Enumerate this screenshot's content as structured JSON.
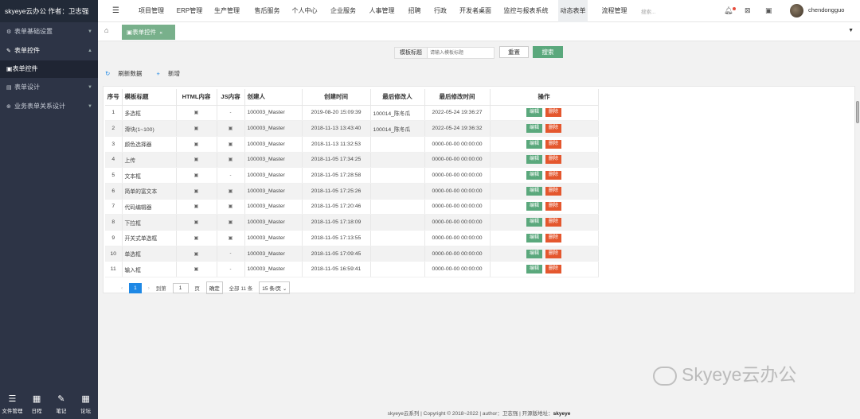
{
  "brand": "skyeye云办公 作者：卫志强",
  "sidebar": {
    "items": [
      {
        "label": "表单基础设置",
        "icon": "users-cog-icon",
        "glyph": "⚙",
        "arrow": "▼",
        "open": false
      },
      {
        "label": "表单控件",
        "icon": "wrench-icon",
        "glyph": "✎",
        "arrow": "▲",
        "open": true
      },
      {
        "label": "表单设计",
        "icon": "layers-icon",
        "glyph": "▤",
        "arrow": "▼",
        "open": false
      },
      {
        "label": "业务表单关系设计",
        "icon": "branch-icon",
        "glyph": "⊕",
        "arrow": "▼",
        "open": false
      }
    ],
    "sub_item": {
      "label": "表单控件",
      "icon": "file-icon",
      "glyph": "▣"
    },
    "bottom_tools": [
      {
        "label": "文件管理",
        "icon": "list-icon",
        "glyph": "☰"
      },
      {
        "label": "日程",
        "icon": "calendar-icon",
        "glyph": "▦"
      },
      {
        "label": "笔记",
        "icon": "edit-icon",
        "glyph": "✎"
      },
      {
        "label": "论坛",
        "icon": "grid-icon",
        "glyph": "▦"
      }
    ]
  },
  "topnav": {
    "menu_glyph": "☰",
    "items": [
      "项目管理",
      "ERP管理",
      "生产管理",
      "售后服务",
      "个人中心",
      "企业服务",
      "人事管理",
      "招聘",
      "行政",
      "开发者桌面",
      "监控与报表系统",
      "动态表单",
      "流程管理"
    ],
    "active_index": 11,
    "search_placeholder": "搜索...",
    "icons": [
      {
        "name": "bell-icon",
        "glyph": "♫"
      },
      {
        "name": "gallery-icon",
        "glyph": "⊠"
      },
      {
        "name": "window-icon",
        "glyph": "▣"
      }
    ],
    "notification_color": "#e74c3c",
    "username": "chendongguo"
  },
  "tabs": {
    "home_glyph": "⌂",
    "active": {
      "label": "表单控件",
      "icon_glyph": "▣",
      "close_glyph": "✕"
    },
    "dropdown_glyph": "▼"
  },
  "search": {
    "label": "模板标题",
    "placeholder": "请输入模板标题",
    "reset_label": "重置",
    "search_label": "搜索"
  },
  "toolbar": {
    "refresh_label": "刷新数据",
    "refresh_glyph": "↻",
    "add_label": "新增",
    "add_glyph": "+"
  },
  "table": {
    "headers": [
      "序号",
      "模板标题",
      "HTML内容",
      "JS内容",
      "创建人",
      "创建时间",
      "最后修改人",
      "最后修改时间",
      "操作"
    ],
    "edit_label": "编辑",
    "delete_label": "删除",
    "rows": [
      {
        "no": "1",
        "title": "多选框",
        "html": "▣",
        "js": "-",
        "creator": "100003_Master",
        "created": "2019-08-20 15:09:39",
        "modifier": "100014_陈冬瓜",
        "modified": "2022-05-24 19:36:27"
      },
      {
        "no": "2",
        "title": "滑块(1~100)",
        "html": "▣",
        "js": "▣",
        "creator": "100003_Master",
        "created": "2018-11-13 13:43:40",
        "modifier": "100014_陈冬瓜",
        "modified": "2022-05-24 19:36:32"
      },
      {
        "no": "3",
        "title": "颜色选择器",
        "html": "▣",
        "js": "▣",
        "creator": "100003_Master",
        "created": "2018-11-13 11:32:53",
        "modifier": "",
        "modified": "0000-00-00 00:00:00"
      },
      {
        "no": "4",
        "title": "上传",
        "html": "▣",
        "js": "▣",
        "creator": "100003_Master",
        "created": "2018-11-05 17:34:25",
        "modifier": "",
        "modified": "0000-00-00 00:00:00"
      },
      {
        "no": "5",
        "title": "文本框",
        "html": "▣",
        "js": "-",
        "creator": "100003_Master",
        "created": "2018-11-05 17:28:58",
        "modifier": "",
        "modified": "0000-00-00 00:00:00"
      },
      {
        "no": "6",
        "title": "简单的富文本",
        "html": "▣",
        "js": "▣",
        "creator": "100003_Master",
        "created": "2018-11-05 17:25:26",
        "modifier": "",
        "modified": "0000-00-00 00:00:00"
      },
      {
        "no": "7",
        "title": "代码编辑器",
        "html": "▣",
        "js": "▣",
        "creator": "100003_Master",
        "created": "2018-11-05 17:20:46",
        "modifier": "",
        "modified": "0000-00-00 00:00:00"
      },
      {
        "no": "8",
        "title": "下拉框",
        "html": "▣",
        "js": "▣",
        "creator": "100003_Master",
        "created": "2018-11-05 17:18:09",
        "modifier": "",
        "modified": "0000-00-00 00:00:00"
      },
      {
        "no": "9",
        "title": "开关式单选框",
        "html": "▣",
        "js": "▣",
        "creator": "100003_Master",
        "created": "2018-11-05 17:13:55",
        "modifier": "",
        "modified": "0000-00-00 00:00:00"
      },
      {
        "no": "10",
        "title": "单选框",
        "html": "▣",
        "js": "-",
        "creator": "100003_Master",
        "created": "2018-11-05 17:09:45",
        "modifier": "",
        "modified": "0000-00-00 00:00:00"
      },
      {
        "no": "11",
        "title": "输入框",
        "html": "▣",
        "js": "-",
        "creator": "100003_Master",
        "created": "2018-11-05 16:59:41",
        "modifier": "",
        "modified": "0000-00-00 00:00:00"
      }
    ]
  },
  "pager": {
    "prev": "‹",
    "current": "1",
    "next": "›",
    "goto_label": "到第",
    "page_value": "1",
    "page_unit": "页",
    "confirm_label": "确定",
    "total": "全部 11 条",
    "page_size": "15 条/页"
  },
  "watermark": "Skyeye云办公",
  "footer": {
    "text": "skyeye云系列 | Copyright © 2018~2022 | author：卫志强 | 开源版地址：",
    "link": "skyeye"
  },
  "colors": {
    "accent_green": "#5aa87c",
    "danger_red": "#e4572e",
    "sidebar_bg": "#2d3446",
    "link_blue": "#1e88e5"
  }
}
